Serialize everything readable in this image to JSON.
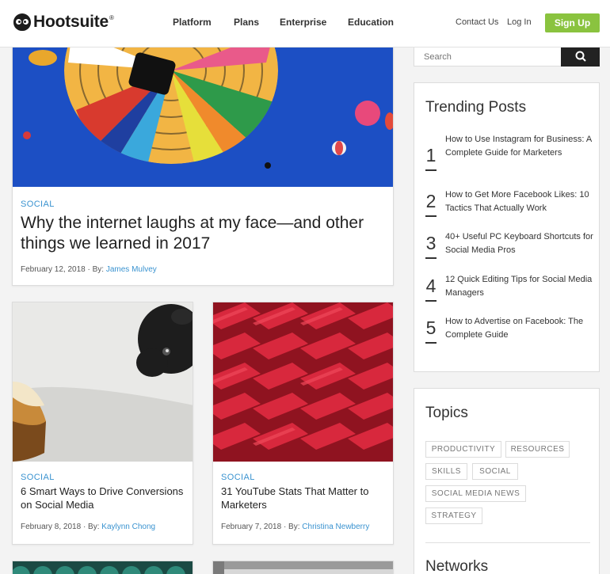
{
  "header": {
    "brand": "Hootsuite",
    "registered": "®",
    "nav": [
      "Platform",
      "Plans",
      "Enterprise",
      "Education"
    ],
    "contact": "Contact Us",
    "login": "Log In",
    "signup": "Sign Up"
  },
  "search": {
    "placeholder": "Search"
  },
  "featured": {
    "category": "SOCIAL",
    "title": "Why the internet laughs at my face—and other things we learned in 2017",
    "date": "February 12, 2018",
    "by": "· By:",
    "author": "James Mulvey"
  },
  "posts": [
    {
      "category": "SOCIAL",
      "title": "6 Smart Ways to Drive Conversions on Social Media",
      "date": "February 8, 2018",
      "by": "· By:",
      "author": "Kaylynn Chong"
    },
    {
      "category": "SOCIAL",
      "title": "31 YouTube Stats That Matter to Marketers",
      "date": "February 7, 2018",
      "by": "· By:",
      "author": "Christina Newberry"
    }
  ],
  "trending": {
    "title": "Trending Posts",
    "items": [
      {
        "num": "1",
        "text": "How to Use Instagram for Business: A Complete Guide for Marketers"
      },
      {
        "num": "2",
        "text": "How to Get More Facebook Likes: 10 Tactics That Actually Work"
      },
      {
        "num": "3",
        "text": "40+ Useful PC Keyboard Shortcuts for Social Media Pros"
      },
      {
        "num": "4",
        "text": "12 Quick Editing Tips for Social Media Managers"
      },
      {
        "num": "5",
        "text": "How to Advertise on Facebook: The Complete Guide"
      }
    ]
  },
  "topics": {
    "title": "Topics",
    "tags": [
      "PRODUCTIVITY",
      "RESOURCES",
      "SKILLS",
      "SOCIAL",
      "SOCIAL MEDIA NEWS",
      "STRATEGY"
    ]
  },
  "networks": {
    "title": "Networks"
  },
  "colors": {
    "accent": "#3a93d0",
    "signup": "#8ac33f",
    "sky": "#1c4fc4",
    "seats": "#d8283d"
  },
  "icons": {
    "logo": "owl-icon",
    "search": "search-icon"
  }
}
